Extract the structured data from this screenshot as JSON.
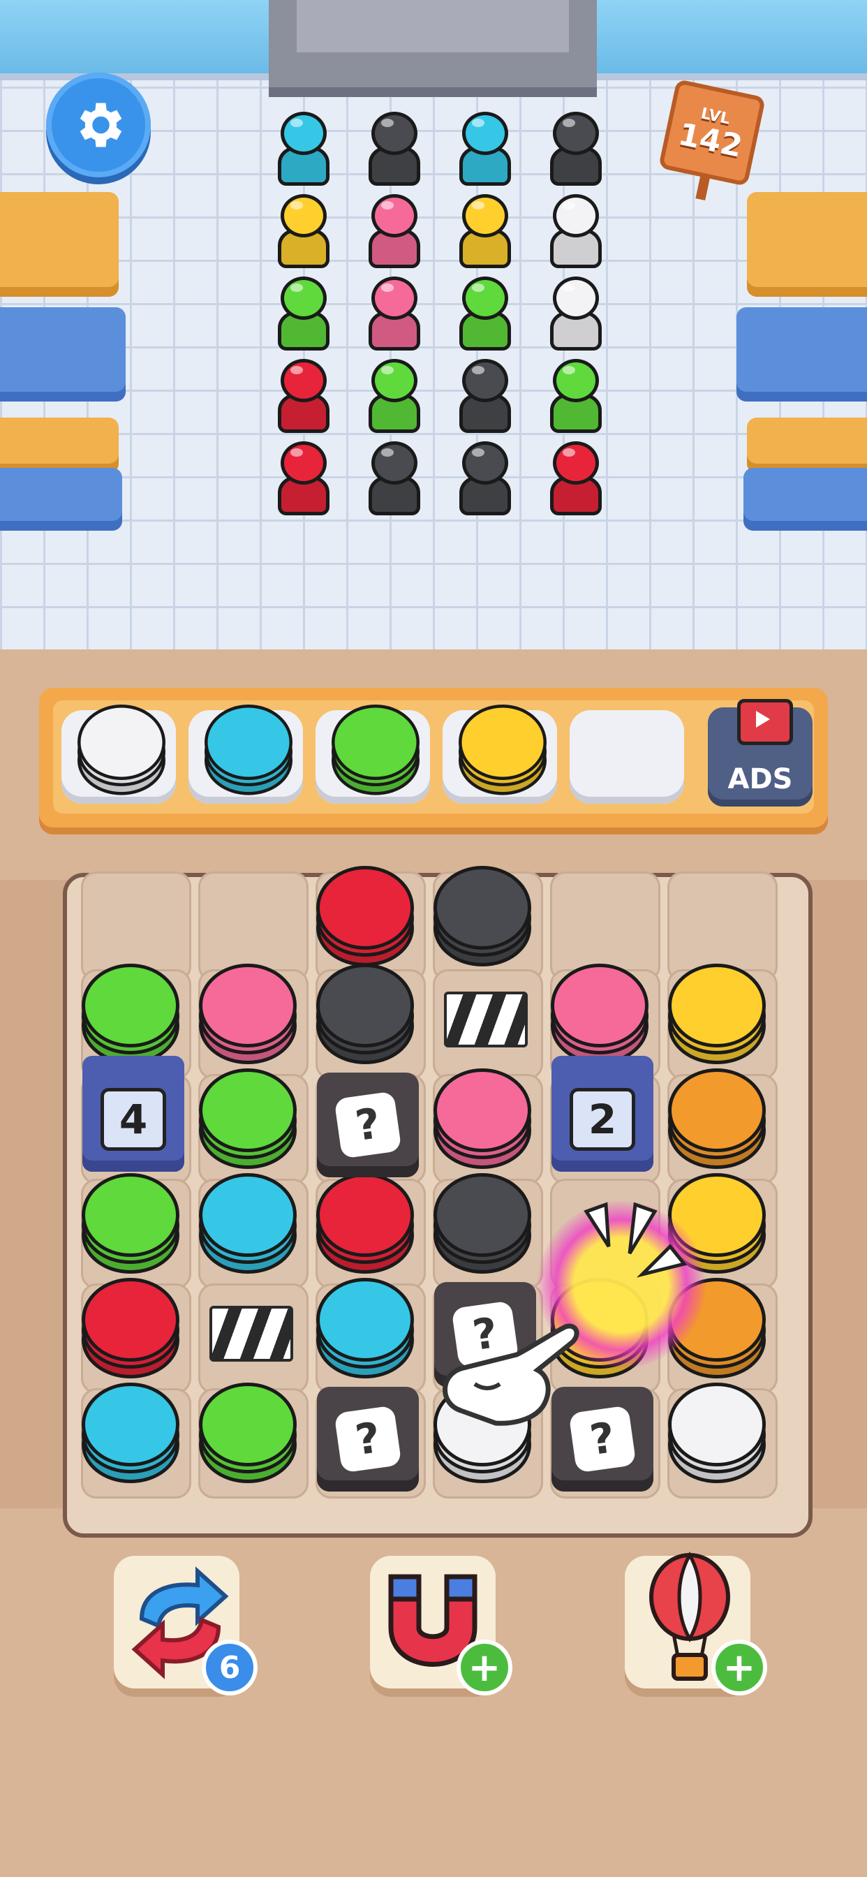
{
  "level": {
    "label": "LVL",
    "number": "142"
  },
  "queue_columns": [
    [
      "cyan",
      "yellow",
      "green",
      "red",
      "red"
    ],
    [
      "black",
      "pink",
      "pink",
      "green",
      "black"
    ],
    [
      "cyan",
      "yellow",
      "green",
      "black",
      "black"
    ],
    [
      "black",
      "white",
      "white",
      "green",
      "red"
    ]
  ],
  "tray": {
    "slots": [
      "white",
      "cyan",
      "green",
      "yellow",
      "empty"
    ],
    "ads_label": "ADS"
  },
  "board": {
    "cakes": [
      {
        "col": 2,
        "row": 0,
        "color": "red"
      },
      {
        "col": 3,
        "row": 0,
        "color": "black"
      },
      {
        "col": 0,
        "row": 1,
        "color": "green"
      },
      {
        "col": 1,
        "row": 1,
        "color": "pink"
      },
      {
        "col": 2,
        "row": 1,
        "color": "black"
      },
      {
        "col": 4,
        "row": 1,
        "color": "pink"
      },
      {
        "col": 5,
        "row": 1,
        "color": "yellow"
      },
      {
        "col": 1,
        "row": 2,
        "color": "green"
      },
      {
        "col": 3,
        "row": 2,
        "color": "pink"
      },
      {
        "col": 5,
        "row": 2,
        "color": "orange"
      },
      {
        "col": 0,
        "row": 3,
        "color": "green"
      },
      {
        "col": 1,
        "row": 3,
        "color": "cyan"
      },
      {
        "col": 2,
        "row": 3,
        "color": "red"
      },
      {
        "col": 3,
        "row": 3,
        "color": "black"
      },
      {
        "col": 5,
        "row": 3,
        "color": "yellow"
      },
      {
        "col": 0,
        "row": 4,
        "color": "red"
      },
      {
        "col": 2,
        "row": 4,
        "color": "cyan"
      },
      {
        "col": 4,
        "row": 4,
        "color": "yellow"
      },
      {
        "col": 5,
        "row": 4,
        "color": "orange"
      },
      {
        "col": 0,
        "row": 5,
        "color": "cyan"
      },
      {
        "col": 1,
        "row": 5,
        "color": "green"
      },
      {
        "col": 3,
        "row": 5,
        "color": "white"
      },
      {
        "col": 5,
        "row": 5,
        "color": "white"
      }
    ],
    "mystery_blocks": [
      {
        "col": 2,
        "row": 2,
        "label": "?"
      },
      {
        "col": 3,
        "row": 4,
        "label": "?"
      },
      {
        "col": 2,
        "row": 5,
        "label": "?"
      },
      {
        "col": 4,
        "row": 5,
        "label": "?"
      }
    ],
    "locked_boxes": [
      {
        "col": 0,
        "row": 2,
        "count": "4"
      },
      {
        "col": 4,
        "row": 2,
        "count": "2"
      }
    ],
    "striped_blocks": [
      {
        "col": 3,
        "row": 1
      },
      {
        "col": 1,
        "row": 4
      }
    ]
  },
  "boosters": {
    "shuffle": {
      "icon": "shuffle-arrows-icon",
      "count": "6"
    },
    "magnet": {
      "icon": "magnet-icon",
      "badge": "+"
    },
    "balloon": {
      "icon": "hot-air-balloon-icon",
      "badge": "+"
    }
  },
  "colors": {
    "red": "#e8243a",
    "black": "#4a4b50",
    "cyan": "#36c7e6",
    "yellow": "#ffcf2e",
    "green": "#5fd93c",
    "pink": "#f66a9a",
    "white": "#f3f3f6",
    "orange": "#f39a2c"
  }
}
